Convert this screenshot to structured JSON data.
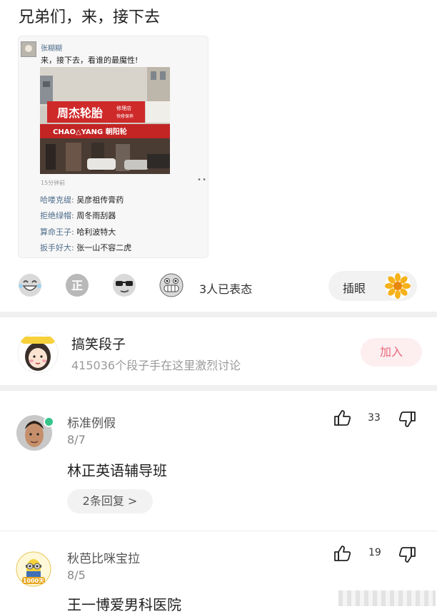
{
  "post": {
    "title": "兄弟们，来，接下去",
    "card": {
      "username": "张糊糊",
      "text": "来，接下去，看谁的最魔性!",
      "photo_sign_main": "周杰轮胎",
      "photo_sign_side_top": "修理店",
      "photo_sign_side_bottom": "快修保养",
      "photo_sign_lower": "CHAO△YANG 朝阳轮",
      "time": "15分钟前",
      "lines": [
        {
          "who": "哈喽克缇:",
          "what": "吴彦祖传膏药"
        },
        {
          "who": "拒绝绿帽:",
          "what": "周冬雨刮器"
        },
        {
          "who": "算命王子:",
          "what": "哈利波特大"
        },
        {
          "who": "扳手好大:",
          "what": "张一山不容二虎"
        }
      ]
    }
  },
  "reactions": {
    "icons": [
      "laughing-emoji",
      "zheng-emoji",
      "sunglasses-emoji",
      "grinning-emoji"
    ],
    "count_text": "3人已表态",
    "tag_label": "插眼",
    "tag_icon": "sunflower-icon"
  },
  "group": {
    "name": "搞笑段子",
    "description": "415036个段子手在这里激烈讨论",
    "join_label": "加入"
  },
  "comments": [
    {
      "name": "标准例假",
      "date": "8/7",
      "text": "林正英语辅导班",
      "likes": "33",
      "replies": "2条回复 >"
    },
    {
      "name": "秋芭比咪宝拉",
      "date": "8/5",
      "text": "王一博爱男科医院",
      "likes": "19",
      "badge": "1000天"
    }
  ],
  "colors": {
    "accent": "#e8697c",
    "online": "#35c48a"
  }
}
